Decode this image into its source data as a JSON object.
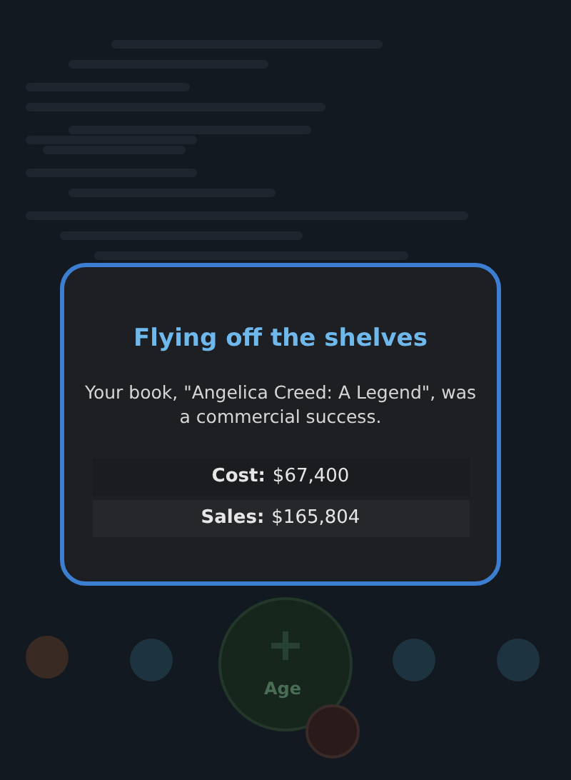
{
  "background": {
    "age_button": {
      "label": "Age"
    }
  },
  "dialog": {
    "title": "Flying off the shelves",
    "message": "Your book, \"Angelica Creed: A Legend\", was a commercial success.",
    "rows": [
      {
        "label": "Cost:",
        "value": "$67,400"
      },
      {
        "label": "Sales:",
        "value": "$165,804"
      }
    ]
  }
}
